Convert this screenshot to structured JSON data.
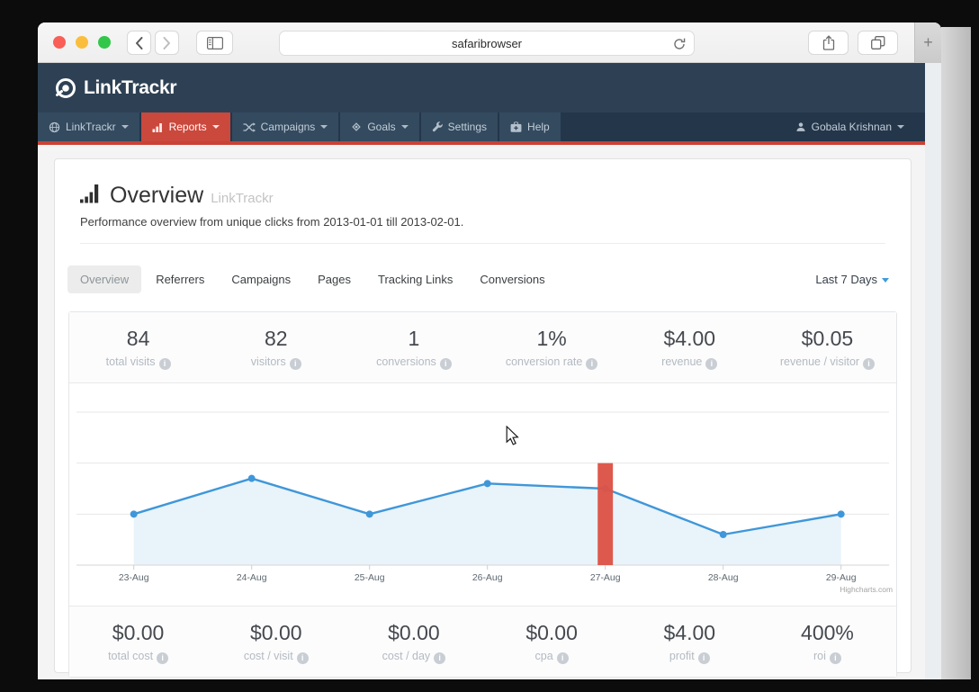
{
  "browser": {
    "address_value": "safaribrowser",
    "new_tab_label": "+"
  },
  "app": {
    "brand": "LinkTrackr",
    "nav": [
      {
        "label": "LinkTrackr",
        "icon": "globe-icon",
        "caret": true
      },
      {
        "label": "Reports",
        "icon": "bar-chart-icon",
        "caret": true,
        "active": true
      },
      {
        "label": "Campaigns",
        "icon": "shuffle-icon",
        "caret": true
      },
      {
        "label": "Goals",
        "icon": "target-icon",
        "caret": true
      },
      {
        "label": "Settings",
        "icon": "wrench-icon",
        "caret": false
      },
      {
        "label": "Help",
        "icon": "medkit-icon",
        "caret": false
      }
    ],
    "user": "Gobala Krishnan"
  },
  "page": {
    "title": "Overview",
    "title_suffix": "LinkTrackr",
    "subtitle": "Performance overview from unique clicks from 2013-01-01 till 2013-02-01.",
    "tabs": [
      {
        "label": "Overview",
        "active": true
      },
      {
        "label": "Referrers"
      },
      {
        "label": "Campaigns"
      },
      {
        "label": "Pages"
      },
      {
        "label": "Tracking Links"
      },
      {
        "label": "Conversions"
      }
    ],
    "date_filter": "Last 7 Days",
    "stats_top": [
      {
        "value": "84",
        "label": "total visits"
      },
      {
        "value": "82",
        "label": "visitors"
      },
      {
        "value": "1",
        "label": "conversions"
      },
      {
        "value": "1%",
        "label": "conversion rate"
      },
      {
        "value": "$4.00",
        "label": "revenue"
      },
      {
        "value": "$0.05",
        "label": "revenue / visitor"
      }
    ],
    "stats_bottom": [
      {
        "value": "$0.00",
        "label": "total cost"
      },
      {
        "value": "$0.00",
        "label": "cost / visit"
      },
      {
        "value": "$0.00",
        "label": "cost / day"
      },
      {
        "value": "$0.00",
        "label": "cpa"
      },
      {
        "value": "$4.00",
        "label": "profit"
      },
      {
        "value": "400%",
        "label": "roi"
      }
    ]
  },
  "chart_data": {
    "type": "area",
    "x": [
      "23-Aug",
      "24-Aug",
      "25-Aug",
      "26-Aug",
      "27-Aug",
      "28-Aug",
      "29-Aug"
    ],
    "series": [
      {
        "name": "visits",
        "type": "area-line",
        "color": "#3f97d9",
        "area_fill": "#e9f3fa",
        "values": [
          10,
          17,
          10,
          16,
          15,
          6,
          10
        ]
      },
      {
        "name": "highlight-column",
        "type": "column",
        "color": "#dd5246",
        "x": "27-Aug",
        "value": 20
      }
    ],
    "ylim": [
      0,
      30
    ],
    "gridlines": [
      10,
      20,
      30
    ],
    "grid": true,
    "legend": "none",
    "y_axis_labels": "hidden",
    "credit": "Highcharts.com"
  },
  "icons": {
    "browser": [
      "close",
      "minimize",
      "zoom",
      "back",
      "forward",
      "sidebar",
      "reload",
      "share",
      "tabs-overview",
      "new-tab"
    ],
    "app": [
      "brand-mark",
      "globe",
      "bar-chart",
      "shuffle",
      "target",
      "wrench",
      "medkit",
      "user",
      "caret-down",
      "info",
      "chart-title-bars",
      "cursor-pointer"
    ]
  },
  "colors": {
    "header_navy": "#2e4154",
    "nav_button_navy": "#334a5f",
    "accent_red": "#ca4136",
    "active_nav_red": "#cb483c",
    "chart_line_blue": "#3f97d9",
    "chart_area_blue": "#e9f3fa",
    "annotation_bar_red": "#dd5246"
  }
}
